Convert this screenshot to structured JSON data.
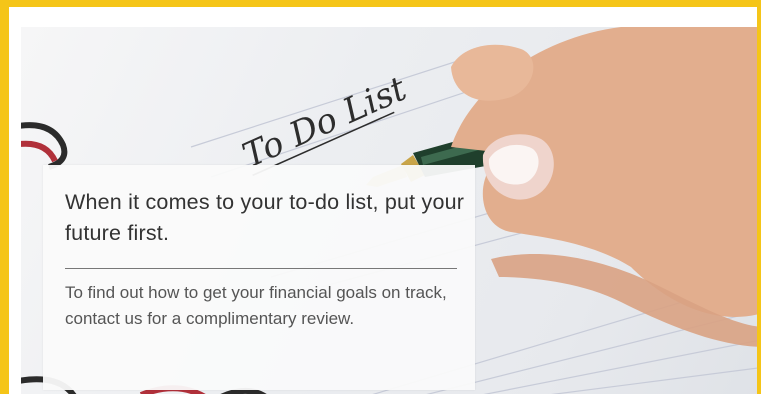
{
  "photo": {
    "handwritten_text": "To Do List"
  },
  "card": {
    "headline": "When it comes to your to-do list, put your future first.",
    "body": "To find out how to get your financial goals on track, contact us for a complimentary review."
  },
  "colors": {
    "frame": "#f5c518",
    "card_background": "#fafafa",
    "headline_text": "#333333",
    "body_text": "#555555",
    "pen_barrel": "#1f3f2c",
    "pen_trim": "#c9a548"
  }
}
